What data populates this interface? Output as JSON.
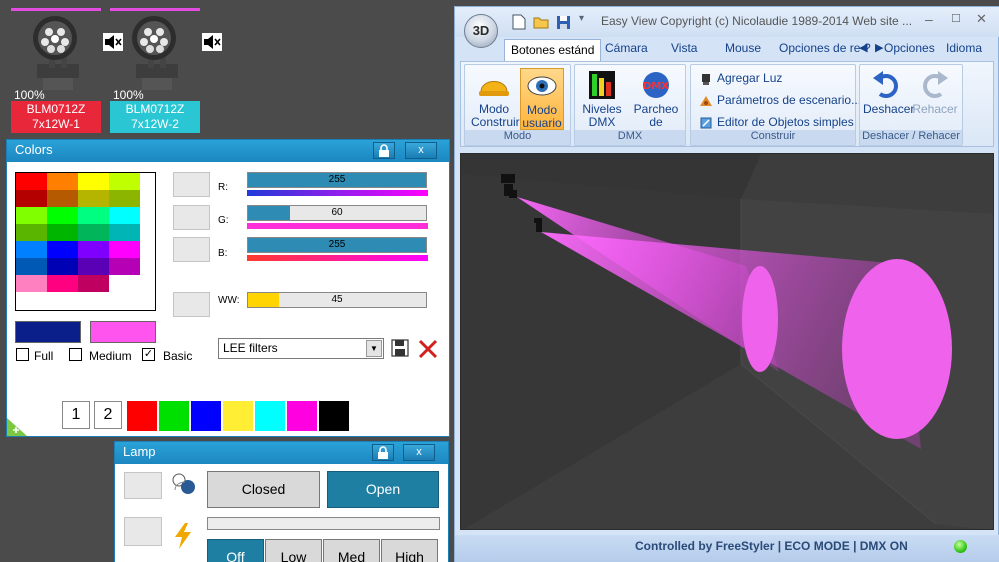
{
  "fixtures": [
    {
      "percent": "100%",
      "model": "BLM0712Z",
      "name": "7x12W-1",
      "color": "#e8283a"
    },
    {
      "percent": "100%",
      "model": "BLM0712Z",
      "name": "7x12W-2",
      "color": "#2bc6d4"
    }
  ],
  "colors_panel": {
    "title": "Colors",
    "lock_icon": "lock-icon",
    "close_label": "x",
    "palette": [
      [
        "#ff0000",
        "#ff7f00",
        "#ffff00",
        "#c0ff00"
      ],
      [
        "#b50000",
        "#b55a00",
        "#b5b500",
        "#8cb500"
      ],
      [
        "#7fff00",
        "#00ff00",
        "#00ff80",
        "#00ffff"
      ],
      [
        "#5ab500",
        "#00b500",
        "#00b55a",
        "#00b5b5"
      ],
      [
        "#0080ff",
        "#0000ff",
        "#8000ff",
        "#ff00ff"
      ],
      [
        "#005ab5",
        "#0000b5",
        "#5a00b5",
        "#b500b5"
      ],
      [
        "#ff80c0",
        "#ff0080",
        "#c00060",
        "#ffffff"
      ]
    ],
    "channels": {
      "r": {
        "label": "R:",
        "value": "255",
        "level": 1.0,
        "color": "#ff0000"
      },
      "g": {
        "label": "G:",
        "value": "60",
        "level": 0.235,
        "color": "#ff00ff"
      },
      "b": {
        "label": "B:",
        "value": "255",
        "level": 1.0,
        "color": "#ff3000"
      },
      "ww": {
        "label": "WW:",
        "value": "45",
        "level": 0.176,
        "color": "#ffd400"
      }
    },
    "current_color_a": "#0a1f8a",
    "current_color_b": "#ff55ee",
    "checkboxes": [
      {
        "label": "Full",
        "checked": false
      },
      {
        "label": "Medium",
        "checked": false
      },
      {
        "label": "Basic",
        "checked": true
      }
    ],
    "filter_select": "LEE filters",
    "save_icon": "floppy-icon",
    "delete_icon": "delete-x-icon",
    "pages": [
      "1",
      "2"
    ],
    "quick_colors": [
      "#ff0000",
      "#00e000",
      "#0000ff",
      "#ffee33",
      "#00ffff",
      "#ff00e0",
      "#000000"
    ]
  },
  "lamp_panel": {
    "title": "Lamp",
    "close_label": "x",
    "closed_label": "Closed",
    "open_label": "Open",
    "levels": [
      "Off",
      "Low",
      "Med",
      "High"
    ]
  },
  "window": {
    "orb_label": "3D",
    "title": "Easy View   Copyright (c) Nicolaudie 1989-2014   Web site ...",
    "tabs": [
      "Botones estánd",
      "Cámara",
      "Vista",
      "Mouse",
      "Opciones de re"
    ],
    "right_menus": [
      "?",
      "Opciones",
      "Idioma"
    ],
    "groups": {
      "modo": {
        "label": "Modo",
        "buttons": [
          "Modo Construir",
          "Modo usuario"
        ]
      },
      "dmx": {
        "label": "DMX",
        "buttons": [
          "Niveles DMX",
          "Parcheo de Universos"
        ]
      },
      "construir": {
        "label": "Construir",
        "buttons": [
          "Agregar Luz",
          "Parámetros de escenario...",
          "Editor de Objetos simples"
        ]
      },
      "undo": {
        "label": "Deshacer / Rehacer",
        "buttons": [
          "Deshacer",
          "Rehacer"
        ]
      }
    },
    "status": "Controlled by FreeStyler   |   ECO MODE   |   DMX ON"
  }
}
